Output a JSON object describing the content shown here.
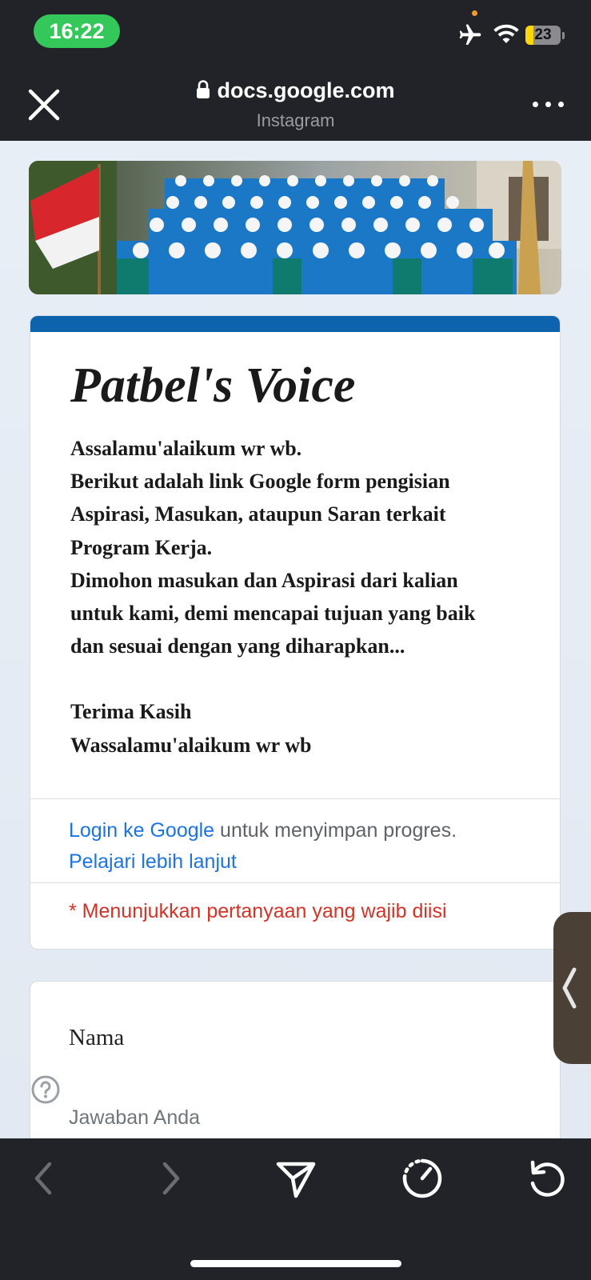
{
  "status_bar": {
    "time": "16:22",
    "battery": "23",
    "battery_level": 0.23,
    "icons": [
      "airplane-icon",
      "wifi-icon",
      "battery-icon"
    ]
  },
  "browser": {
    "url": "docs.google.com",
    "source": "Instagram",
    "close_icon": "close-icon",
    "more_icon": "more-dots-icon"
  },
  "form": {
    "title": "Patbel's Voice",
    "description_lines": [
      "Assalamu'alaikum wr wb.",
      "Berikut adalah link Google form pengisian",
      "Aspirasi, Masukan, ataupun Saran terkait",
      "Program Kerja.",
      "Dimohon masukan dan Aspirasi dari kalian",
      "untuk kami, demi mencapai tujuan yang baik",
      "dan sesuai dengan yang diharapkan...",
      "",
      "Terima Kasih",
      "Wassalamu'alaikum wr wb"
    ],
    "login_link": "Login ke Google",
    "login_rest": " untuk menyimpan progres.",
    "learn_more": "Pelajari lebih lanjut",
    "required_note": "* Menunjukkan pertanyaan yang wajib diisi",
    "accent_color": "#0d64ad",
    "question": {
      "label": "Nama",
      "placeholder": "Jawaban Anda"
    }
  },
  "toolbar": {
    "icons": [
      "back-arrow-icon",
      "forward-arrow-icon",
      "send-icon",
      "speed-icon",
      "reload-icon"
    ]
  }
}
